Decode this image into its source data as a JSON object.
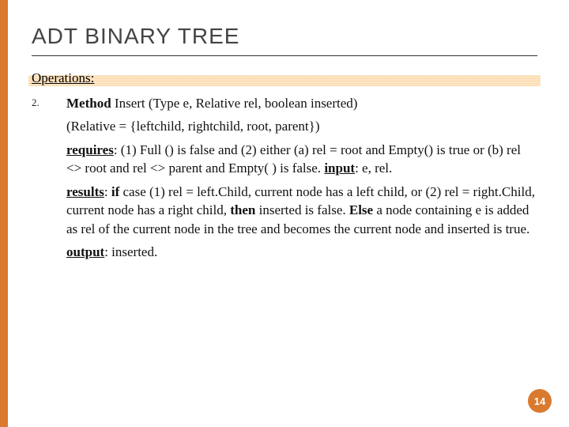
{
  "title": "ADT BINARY TREE",
  "operations_label": "Operations:",
  "item_number": "2.",
  "method_label": "Method",
  "method_sig": " Insert (Type e, Relative rel, boolean inserted)",
  "relative_def": "(Relative = {leftchild, rightchild, root, parent})",
  "requires_label": "requires",
  "requires_text": ": (1) Full () is false and (2) either (a) rel = root and Empty() is true or (b) rel <> root and rel <> parent and Empty( ) is false.  ",
  "input_label": "input",
  "input_text": ": e, rel.",
  "results_label": "results",
  "results_span1": ": ",
  "if_label": "if",
  "results_span2": " case (1) rel = left.Child, current node has a left child, or (2) rel = right.Child, current node has a right child, ",
  "then_label": "then",
  "results_span3": " inserted is false. ",
  "else_label": "Else",
  "results_span4": " a node containing e is added as rel of the current node in the tree and becomes the current node and inserted is true.",
  "output_label": "output",
  "output_text": ": inserted.",
  "page_number": "14"
}
